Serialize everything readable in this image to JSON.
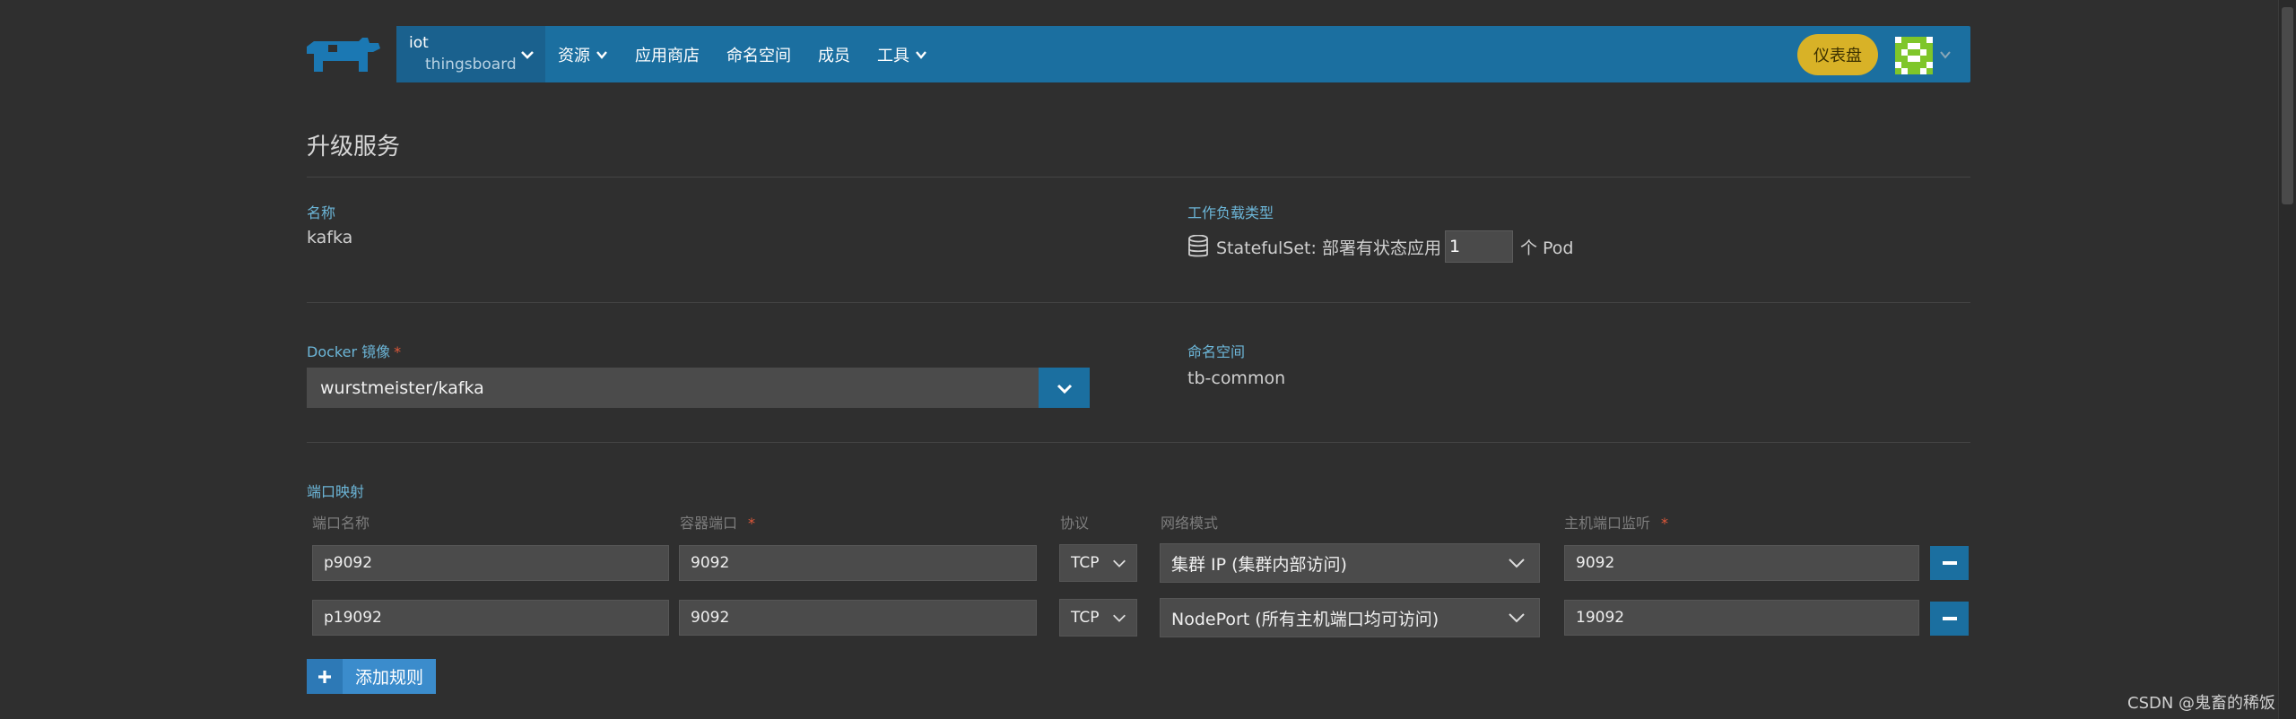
{
  "header": {
    "environment": {
      "name": "iot",
      "project": "thingsboard"
    },
    "nav": [
      {
        "label": "资源",
        "dropdown": true
      },
      {
        "label": "应用商店",
        "dropdown": false
      },
      {
        "label": "命名空间",
        "dropdown": false
      },
      {
        "label": "成员",
        "dropdown": false
      },
      {
        "label": "工具",
        "dropdown": true
      }
    ],
    "dashboard_label": "仪表盘"
  },
  "page": {
    "title": "升级服务",
    "name_label": "名称",
    "name_value": "kafka",
    "workload_label": "工作负载类型",
    "workload_text": "StatefulSet: 部署有状态应用",
    "pod_count": "1",
    "pod_suffix": "个 Pod",
    "image_label": "Docker 镜像",
    "image_value": "wurstmeister/kafka",
    "namespace_label": "命名空间",
    "namespace_value": "tb-common",
    "required_mark": "*"
  },
  "ports": {
    "section_label": "端口映射",
    "headers": {
      "name": "端口名称",
      "container_port": "容器端口",
      "protocol": "协议",
      "network_mode": "网络模式",
      "host_port": "主机端口监听"
    },
    "rows": [
      {
        "name": "p9092",
        "container_port": "9092",
        "protocol": "TCP",
        "network_mode": "集群 IP (集群内部访问)",
        "host_port": "9092"
      },
      {
        "name": "p19092",
        "container_port": "9092",
        "protocol": "TCP",
        "network_mode": "NodePort (所有主机端口均可访问)",
        "host_port": "19092"
      }
    ],
    "add_rule_label": "添加规则"
  },
  "watermark": "CSDN @鬼畜的稀饭",
  "colors": {
    "navbar": "#1b6fa0",
    "accent_blue": "#6cb6d8",
    "dashboard_button": "#d8b227",
    "required": "#e0593a"
  }
}
